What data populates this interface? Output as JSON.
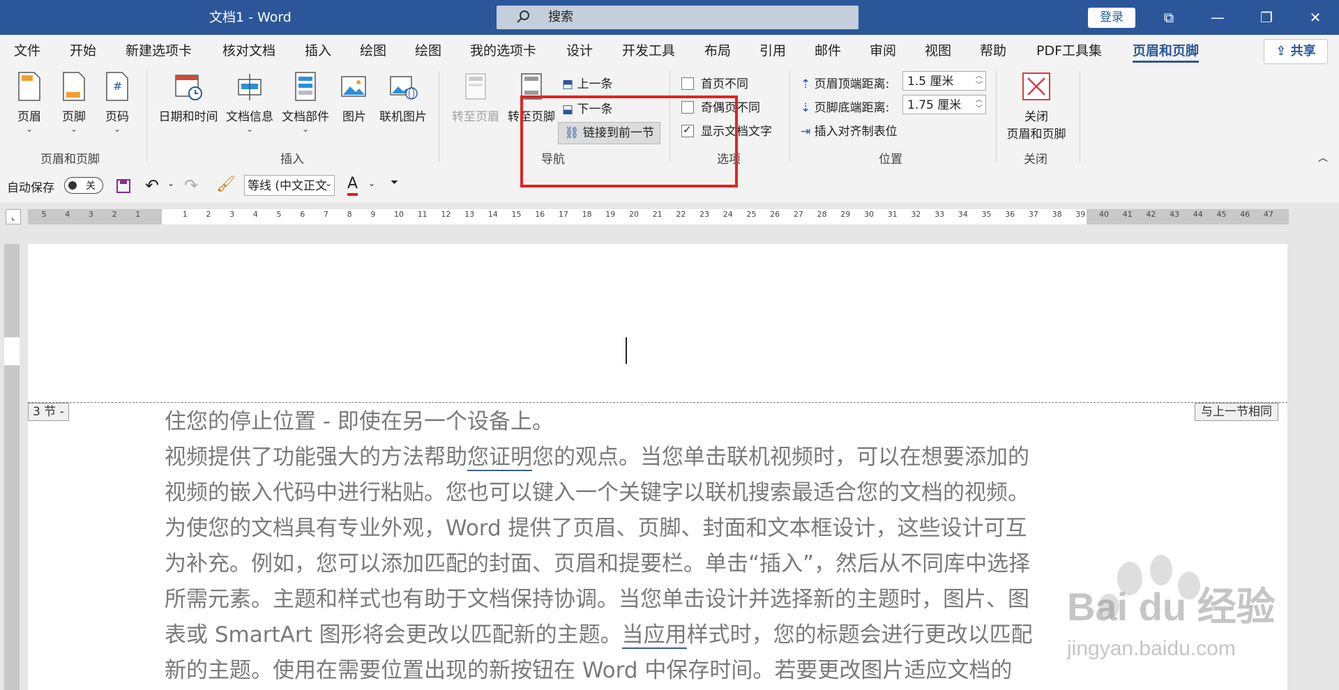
{
  "window": {
    "title": "文档1  -  Word",
    "search_placeholder": "搜索",
    "login_label": "登录",
    "controls": [
      "⧉",
      "—",
      "❐",
      "✕"
    ]
  },
  "tabs": [
    "文件",
    "开始",
    "新建选项卡",
    "核对文档",
    "插入",
    "绘图",
    "绘图",
    "我的选项卡",
    "设计",
    "开发工具",
    "布局",
    "引用",
    "邮件",
    "审阅",
    "视图",
    "帮助",
    "PDF工具集",
    "页眉和页脚"
  ],
  "active_tab": "页眉和页脚",
  "share_label": "共享",
  "ribbon": {
    "group_hf": {
      "label": "页眉和页脚",
      "buttons": [
        "页眉",
        "页脚",
        "页码"
      ]
    },
    "group_insert": {
      "label": "插入",
      "buttons": [
        "日期和时间",
        "文档信息",
        "文档部件",
        "图片",
        "联机图片"
      ]
    },
    "group_nav": {
      "label": "导航",
      "goto_header": "转至页眉",
      "goto_footer": "转至页脚",
      "prev": "上一条",
      "next": "下一条",
      "link_prev": "链接到前一节"
    },
    "group_options": {
      "label": "选项",
      "first_page": "首页不同",
      "odd_even": "奇偶页不同",
      "show_doc_text": "显示文档文字"
    },
    "group_position": {
      "label": "位置",
      "header_top_label": "页眉顶端距离:",
      "header_top_value": "1.5 厘米",
      "footer_bottom_label": "页脚底端距离:",
      "footer_bottom_value": "1.75 厘米",
      "insert_tab": "插入对齐制表位"
    },
    "group_close": {
      "label": "关闭",
      "button": "关闭\n页眉和页脚",
      "line1": "关闭",
      "line2": "页眉和页脚"
    }
  },
  "qat": {
    "autosave_label": "自动保存",
    "autosave_state": "关",
    "font_name": "等线 (中文正文",
    "font_color_letter": "A"
  },
  "document": {
    "section_tag": "3 节 -",
    "same_as_prev": "与上一节相同",
    "lines": [
      "住您的停止位置 - 即使在另一个设备上。",
      "视频提供了功能强大的方法帮助您证明您的观点。当您单击联机视频时，可以在想要添加的",
      "视频的嵌入代码中进行粘贴。您也可以键入一个关键字以联机搜索最适合您的文档的视频。",
      "为使您的文档具有专业外观，Word 提供了页眉、页脚、封面和文本框设计，这些设计可互",
      "为补充。例如，您可以添加匹配的封面、页眉和提要栏。单击“插入”，然后从不同库中选择",
      "所需元素。主题和样式也有助于文档保持协调。当您单击设计并选择新的主题时，图片、图",
      "表或 SmartArt 图形将会更改以匹配新的主题。当应用样式时，您的标题会进行更改以匹配",
      "新的主题。使用在需要位置出现的新按钮在 Word 中保存时间。若要更改图片适应文档的"
    ]
  },
  "watermark": {
    "brand": "Bai du 经验",
    "url": "jingyan.baidu.com"
  },
  "accent": "#2b579a",
  "annotation_color": "#e02424"
}
